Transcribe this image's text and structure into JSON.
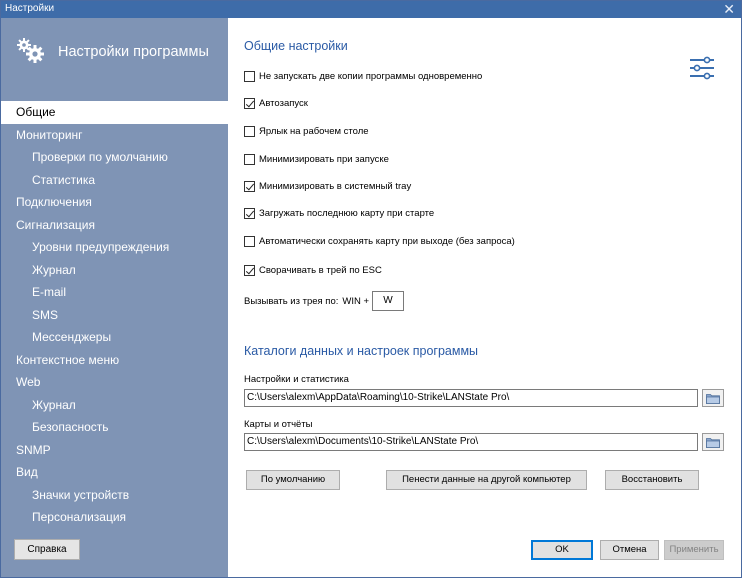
{
  "window": {
    "title": "Настройки",
    "close_glyph": "✕"
  },
  "sidebar": {
    "header": {
      "icon": "gears-icon",
      "text": "Настройки программы"
    },
    "items": [
      {
        "label": "Общие",
        "level": 1,
        "active": true
      },
      {
        "label": "Мониторинг",
        "level": 1
      },
      {
        "label": "Проверки по умолчанию",
        "level": 2
      },
      {
        "label": "Статистика",
        "level": 2
      },
      {
        "label": "Подключения",
        "level": 1
      },
      {
        "label": "Сигнализация",
        "level": 1
      },
      {
        "label": "Уровни предупреждения",
        "level": 2
      },
      {
        "label": "Журнал",
        "level": 2
      },
      {
        "label": "E-mail",
        "level": 2
      },
      {
        "label": "SMS",
        "level": 2
      },
      {
        "label": "Мессенджеры",
        "level": 2
      },
      {
        "label": "Контекстное меню",
        "level": 1
      },
      {
        "label": "Web",
        "level": 1
      },
      {
        "label": "Журнал",
        "level": 2
      },
      {
        "label": "Безопасность",
        "level": 2
      },
      {
        "label": "SNMP",
        "level": 1
      },
      {
        "label": "Вид",
        "level": 1
      },
      {
        "label": "Значки устройств",
        "level": 2
      },
      {
        "label": "Персонализация",
        "level": 2
      }
    ],
    "help_label": "Справка"
  },
  "general": {
    "title": "Общие настройки",
    "options": [
      {
        "label": "Не запускать две копии программы одновременно",
        "checked": false
      },
      {
        "label": "Автозапуск",
        "checked": true
      },
      {
        "label": "Ярлык на рабочем столе",
        "checked": false
      },
      {
        "label": "Минимизировать при запуске",
        "checked": false
      },
      {
        "label": "Минимизировать в системный tray",
        "checked": true
      },
      {
        "label": "Загружать последнюю  карту при старте",
        "checked": true
      },
      {
        "label": "Автоматически сохранять карту при выходе (без запроса)",
        "checked": false
      },
      {
        "label": "Сворачивать в трей по ESC",
        "checked": true
      }
    ],
    "hotkey": {
      "label": "Вызывать из трея по:",
      "modifier": "WIN +",
      "key": "W"
    }
  },
  "catalogs": {
    "title": "Каталоги данных и настроек программы",
    "settings_label": "Настройки и статистика",
    "settings_path": "C:\\Users\\alexm\\AppData\\Roaming\\10-Strike\\LANState Pro\\",
    "maps_label": "Карты и отчёты",
    "maps_path": "C:\\Users\\alexm\\Documents\\10-Strike\\LANState Pro\\",
    "default_btn": "По умолчанию",
    "transfer_btn": "Пенести данные на другой компьютер",
    "restore_btn": "Восстановить"
  },
  "footer": {
    "ok": "OK",
    "cancel": "Отмена",
    "apply": "Применить"
  },
  "colors": {
    "sidebar_bg": "#7f94b5",
    "titlebar_bg": "#3e6ca9",
    "accent": "#2a5aa5"
  }
}
